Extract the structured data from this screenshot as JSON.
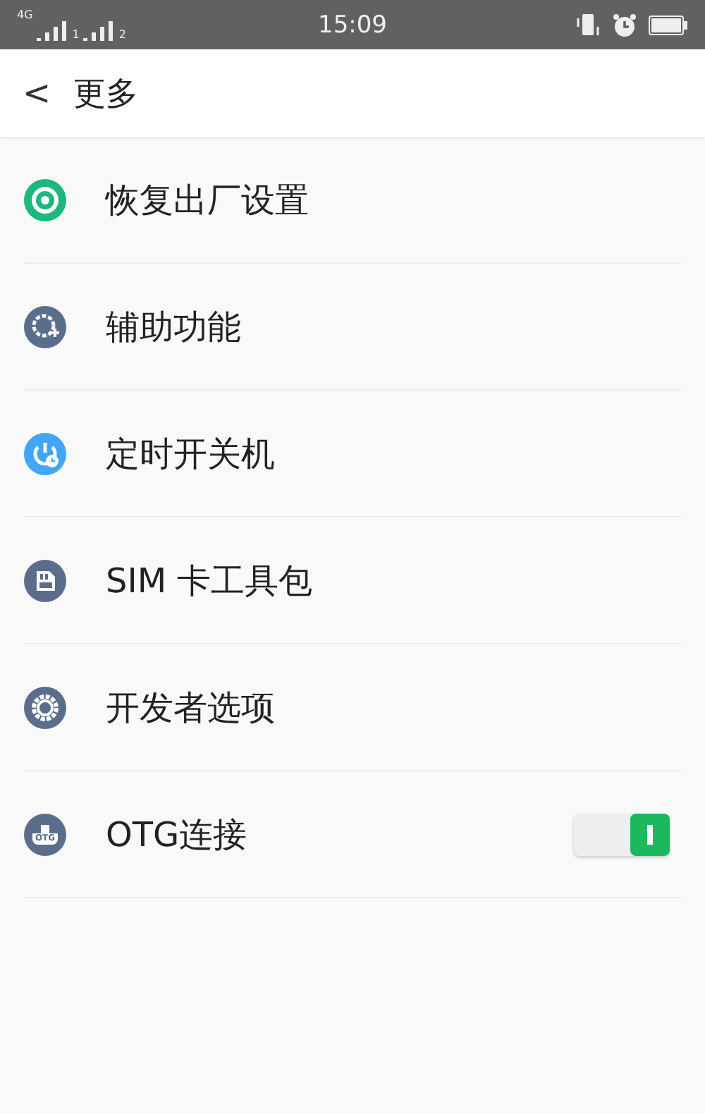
{
  "status_bar": {
    "network": "4G",
    "sim_slots": [
      "1",
      "2"
    ],
    "time": "15:09"
  },
  "header": {
    "back": "<",
    "title": "更多"
  },
  "items": [
    {
      "kind": "link",
      "label": "恢复出厂设置"
    },
    {
      "kind": "link",
      "label": "辅助功能"
    },
    {
      "kind": "link",
      "label": "定时开关机"
    },
    {
      "kind": "link",
      "label": "SIM 卡工具包"
    },
    {
      "kind": "link",
      "label": "开发者选项"
    },
    {
      "kind": "toggle",
      "label": "OTG连接",
      "icon_label": "OTG",
      "on": true
    }
  ]
}
